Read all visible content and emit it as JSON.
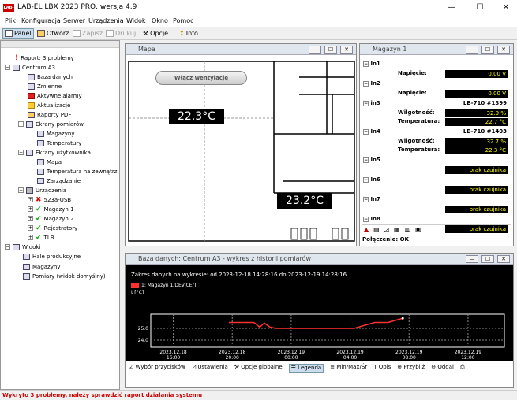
{
  "app": {
    "title": "LAB-EL LBX 2023 PRO, wersja 4.9",
    "logo": "LAB-EL"
  },
  "window_controls": {
    "minimize": "—",
    "maximize": "☐",
    "close": "✕"
  },
  "menu": [
    "Plik",
    "Konfiguracja",
    "Serwer",
    "Urządzenia",
    "Widok",
    "Okno",
    "Pomoc"
  ],
  "toolbar": {
    "panel": "Panel",
    "open": "Otwórz",
    "save": "Zapisz",
    "print": "Drukuj",
    "options": "Opcje",
    "info": "Info"
  },
  "tree": {
    "report": "Raport: 3 problemy",
    "center": "Centrum A3",
    "items": [
      "Baza danych",
      "Zmienne",
      "Aktywne alarmy",
      "Aktualizacje",
      "Raporty PDF"
    ],
    "screens": "Ekrany pomiarów",
    "screens_items": [
      "Magazyny",
      "Temperatury"
    ],
    "user_screens": "Ekrany użytkownika",
    "user_items": [
      "Mapa",
      "Temperatura na zewnątrz",
      "Zarządzanie"
    ],
    "devices": "Urządzenia",
    "device_items": [
      "523a-USB",
      "Magazyn 1",
      "Magazyn 2",
      "Rejestratory",
      "TLB"
    ],
    "views": "Widoki",
    "view_items": [
      "Hale produkcyjne",
      "Magazyny",
      "Pomiary (widok domyślny)"
    ]
  },
  "map": {
    "title": "Mapa",
    "fan_button": "Włącz wentylację",
    "temp1": "22.3°C",
    "temp2": "23.2°C"
  },
  "magazyn": {
    "title": "Magazyn 1",
    "inputs": [
      {
        "name": "In1",
        "rows": [
          {
            "label": "Napięcie:",
            "value": "0.00 V"
          }
        ]
      },
      {
        "name": "In2",
        "rows": [
          {
            "label": "Napięcie:",
            "value": "0.00 V"
          }
        ]
      },
      {
        "name": "in3",
        "device": "LB-710 #1399",
        "rows": [
          {
            "label": "Wilgotność:",
            "value": "32.9 %"
          },
          {
            "label": "Temperatura:",
            "value": "22.7 °C"
          }
        ]
      },
      {
        "name": "In4",
        "device": "LB-710 #1403",
        "rows": [
          {
            "label": "Wilgotność:",
            "value": "32.7 %"
          },
          {
            "label": "Temperatura:",
            "value": "22.3 °C"
          }
        ]
      },
      {
        "name": "In5",
        "rows": [
          {
            "label": "",
            "value": "brak czujnika"
          }
        ]
      },
      {
        "name": "In6",
        "rows": [
          {
            "label": "",
            "value": "brak czujnika"
          }
        ]
      },
      {
        "name": "In7",
        "rows": [
          {
            "label": "",
            "value": "brak czujnika"
          }
        ]
      },
      {
        "name": "In8",
        "rows": [
          {
            "label": "",
            "value": "brak czujnika"
          }
        ]
      }
    ],
    "status": "Połączenie: OK"
  },
  "chart_window": {
    "title": "Baza danych: Centrum A3 - wykres z historii pomiarów",
    "range_text": "Zakres danych na wykresie: od 2023-12-18 14:28:16 do 2023-12-19 14:28:16",
    "buttons": [
      "Wybór przycisków",
      "Ustawienia",
      "Opcje globalne",
      "Legenda",
      "Min/Max/Śr",
      "Opis",
      "Przybliż",
      "Oddal"
    ]
  },
  "chart_data": {
    "type": "line",
    "legend": "1: Magazyn 1/DEVICE/T",
    "ylabel": "t [°C]",
    "ylim": [
      23.4,
      26.2
    ],
    "yticks": [
      25.0,
      24.0
    ],
    "xtick_labels": [
      [
        "2023.12.18",
        "16:00"
      ],
      [
        "2023.12.18",
        "20:00"
      ],
      [
        "2023.12.19",
        "00:00"
      ],
      [
        "2023.12.19",
        "04:00"
      ],
      [
        "2023.12.19",
        "08:00"
      ],
      [
        "2023.12.19",
        "12:00"
      ]
    ],
    "xticks_hours": [
      1.53,
      5.53,
      9.53,
      13.53,
      17.53,
      21.53
    ],
    "xlim": [
      0,
      24
    ],
    "grid": true,
    "series": [
      {
        "name": "Magazyn 1/DEVICE/T",
        "color": "#ff3030",
        "x": [
          5.3,
          6.2,
          7.0,
          7.4,
          7.7,
          8.1,
          8.5,
          12.5,
          13.8,
          15.2,
          16.0,
          16.1,
          17.1
        ],
        "y": [
          25.5,
          25.5,
          25.5,
          25.1,
          25.45,
          25.1,
          25.0,
          25.0,
          25.0,
          25.5,
          25.5,
          25.5,
          25.85
        ]
      }
    ]
  },
  "statusbar": "Wykryto 3 problemy, należy sprawdzić raport działania systemu"
}
